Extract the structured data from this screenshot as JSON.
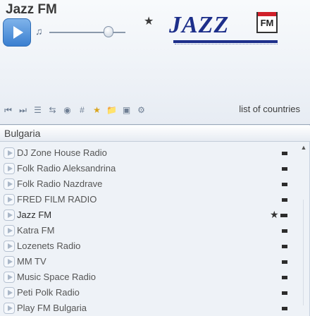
{
  "app": {
    "title": "Jazz FM"
  },
  "player": {
    "volume_level": 0.78,
    "fav_icon": "star-icon",
    "logo": {
      "name": "JAZZ",
      "badge": "FM"
    }
  },
  "toolbar": {
    "icons": [
      "previous-icon",
      "next-icon",
      "stations-icon",
      "shuffle-icon",
      "record-icon",
      "hash-icon",
      "star-icon",
      "folder-icon",
      "window-icon",
      "settings-icon"
    ]
  },
  "header": {
    "countries_link": "list of countries"
  },
  "country": {
    "selected": "Bulgaria"
  },
  "stations": [
    {
      "name": "DJ Zone House Radio",
      "favorite": false
    },
    {
      "name": "Folk Radio Aleksandrina",
      "favorite": false
    },
    {
      "name": "Folk Radio Nazdrave",
      "favorite": false
    },
    {
      "name": "FRED FILM RADIO",
      "favorite": false
    },
    {
      "name": "Jazz FM",
      "favorite": true,
      "selected": true
    },
    {
      "name": "Katra FM",
      "favorite": false
    },
    {
      "name": "Lozenets Radio",
      "favorite": false
    },
    {
      "name": "MM TV",
      "favorite": false
    },
    {
      "name": "Music Space Radio",
      "favorite": false
    },
    {
      "name": "Peti Polk Radio",
      "favorite": false
    },
    {
      "name": "Play FM Bulgaria",
      "favorite": false
    }
  ],
  "scrollbar": {
    "up_arrow": "▲"
  }
}
